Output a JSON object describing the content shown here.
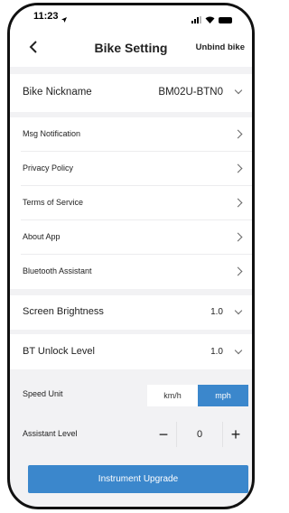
{
  "status_bar": {
    "time": "11:23",
    "location_icon": "location-arrow-icon",
    "signal_icon": "cellular-signal-icon",
    "wifi_icon": "wifi-icon",
    "battery_icon": "battery-icon"
  },
  "header": {
    "back_icon": "chevron-left-icon",
    "title": "Bike Setting",
    "unbind_label": "Unbind bike"
  },
  "nickname": {
    "label": "Bike Nickname",
    "value": "BM02U-BTN0"
  },
  "menu_items": [
    {
      "label": "Msg Notification"
    },
    {
      "label": "Privacy Policy"
    },
    {
      "label": "Terms of Service"
    },
    {
      "label": "About App"
    },
    {
      "label": "Bluetooth Assistant"
    }
  ],
  "screen_brightness": {
    "label": "Screen Brightness",
    "value": "1.0"
  },
  "bt_unlock": {
    "label": "BT Unlock Level",
    "value": "1.0"
  },
  "speed_unit": {
    "label": "Speed Unit",
    "options": [
      "km/h",
      "mph"
    ],
    "selected": "mph"
  },
  "assistant_level": {
    "label": "Assistant Level",
    "minus": "−",
    "value": "0",
    "plus": "+"
  },
  "upgrade_button": {
    "label": "Instrument Upgrade"
  },
  "colors": {
    "accent": "#3b87cc",
    "background": "#f2f2f4"
  }
}
